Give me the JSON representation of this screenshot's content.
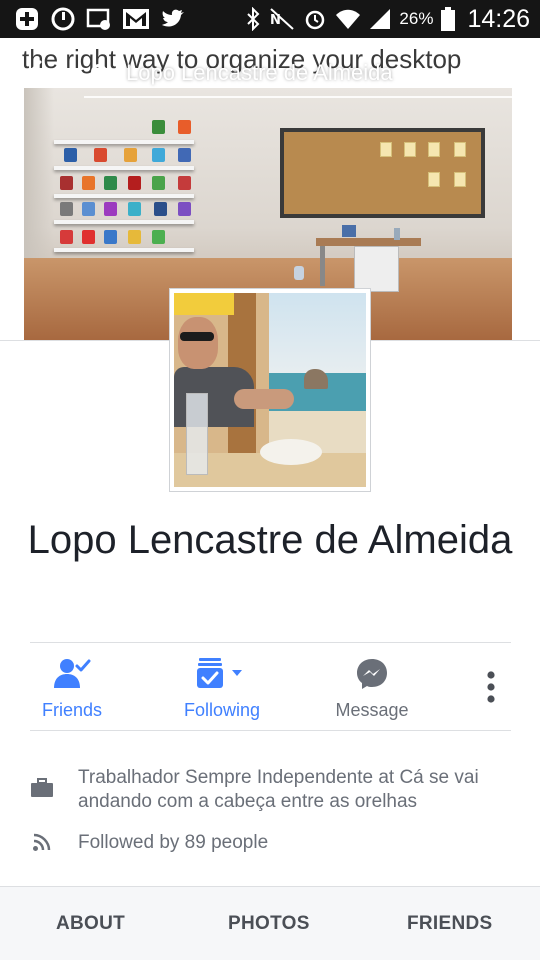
{
  "status_bar": {
    "battery_percent": "26%",
    "time": "14:26",
    "icons": [
      "add-icon",
      "sync-icon",
      "voicemail-icon",
      "gmail-icon",
      "twitter-icon",
      "bluetooth-icon",
      "nfc-icon",
      "alarm-icon",
      "wifi-icon",
      "signal-icon",
      "battery-icon"
    ]
  },
  "cover": {
    "caption": "the right way to organize your desktop"
  },
  "header": {
    "search_text": "Lopo Lencastre de Almeida"
  },
  "profile": {
    "name": "Lopo Lencastre de Almeida"
  },
  "actions": [
    {
      "label": "Friends",
      "icon": "friends-check-icon",
      "color": "#4080ff"
    },
    {
      "label": "Following",
      "icon": "following-icon",
      "color": "#4080ff"
    },
    {
      "label": "Message",
      "icon": "messenger-icon",
      "color": "#6a6f78"
    }
  ],
  "info": {
    "work": "Trabalhador Sempre Independente at Cá se vai andando com a cabeça entre as orelhas",
    "followers": "Followed by 89 people"
  },
  "tabs": [
    "ABOUT",
    "PHOTOS",
    "FRIENDS"
  ],
  "colors": {
    "accent": "#4080ff",
    "text_dark": "#1d2129",
    "text_muted": "#6a6f78",
    "status_bar": "#151515"
  }
}
